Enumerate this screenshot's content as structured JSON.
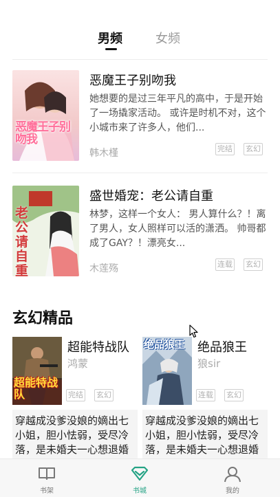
{
  "tabs": {
    "active": "男频",
    "inactive": "女频"
  },
  "books": [
    {
      "title": "恶魔王子别吻我",
      "description": "她想要的是过三年平凡的高中，于是开始了一场撬家活动。 或许是时机不对，这个小城市来了许多人，他们...",
      "author": "韩木槿",
      "tags": [
        "完结",
        "玄幻"
      ],
      "cover_text": "恶魔王子别吻我"
    },
    {
      "title": "盛世婚宠：老公请自重",
      "description": "林梦，这样一个女人： 男人算什么？！离了男人，女人照样可以活的潇洒。 帅哥都成了GAY？！漂亮女...",
      "author": "木莲殇",
      "tags": [
        "连载",
        "玄幻"
      ],
      "cover_text": "老公请自重"
    }
  ],
  "section": {
    "title": "玄幻精品"
  },
  "cards": [
    {
      "name": "超能特战队",
      "author": "鸿蒙",
      "tags": [
        "完结",
        "玄幻"
      ],
      "description": "穿越成没爹没娘的嫡出七小姐，胆小怯弱，受尽冷落，是未婚夫一心想退婚",
      "cover_text": "超能特战队"
    },
    {
      "name": "绝品狼王",
      "author": "狼sir",
      "tags": [
        "连载",
        "玄幻"
      ],
      "description": "穿越成没爹没娘的嫡出七小姐，胆小怯弱，受尽冷落，是未婚夫一心想退婚",
      "cover_text": "绝品狼王"
    }
  ],
  "nav": [
    {
      "label": "书架",
      "icon": "book-icon"
    },
    {
      "label": "书城",
      "icon": "store-icon"
    },
    {
      "label": "我的",
      "icon": "person-icon"
    }
  ],
  "colors": {
    "accent": "#25a385"
  }
}
